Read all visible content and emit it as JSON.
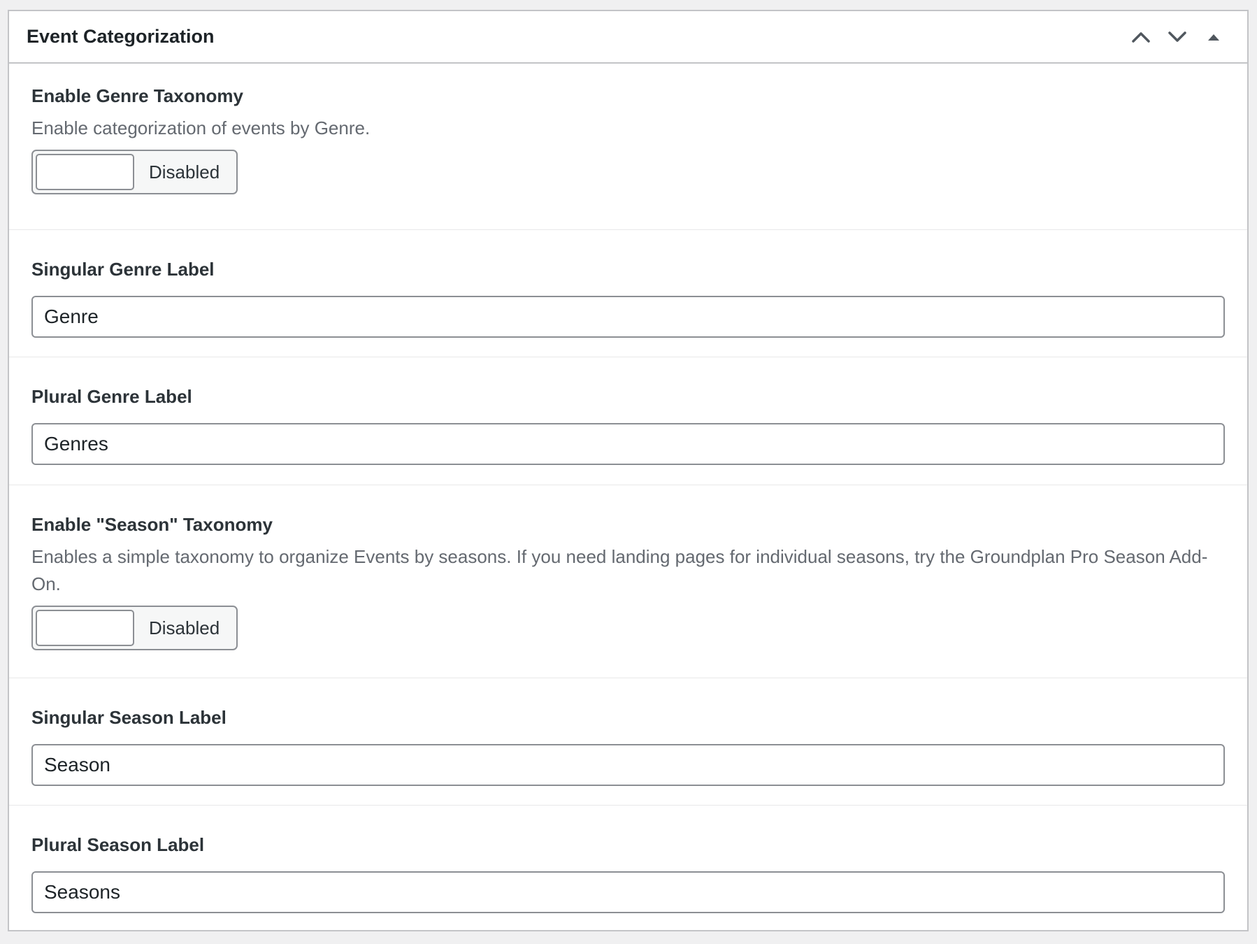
{
  "panel": {
    "title": "Event Categorization",
    "actions": [
      {
        "icon": "chevron-up-icon",
        "label": "Move up"
      },
      {
        "icon": "chevron-down-icon",
        "label": "Move down"
      },
      {
        "icon": "caret-up-icon",
        "label": "Toggle panel"
      }
    ]
  },
  "fields": {
    "genre_toggle": {
      "label": "Enable Genre Taxonomy",
      "description": "Enable categorization of events by Genre.",
      "state": "Disabled"
    },
    "singular_genre": {
      "label": "Singular Genre Label",
      "value": "Genre"
    },
    "plural_genre": {
      "label": "Plural Genre Label",
      "value": "Genres"
    },
    "season_toggle": {
      "label": "Enable \"Season\" Taxonomy",
      "description": "Enables a simple taxonomy to organize Events by seasons. If you need landing pages for individual seasons, try the Groundplan Pro Season Add-On.",
      "state": "Disabled"
    },
    "singular_season": {
      "label": "Singular Season Label",
      "value": "Season"
    },
    "plural_season": {
      "label": "Plural Season Label",
      "value": "Seasons"
    }
  },
  "colors": {
    "border": "#c3c4c7",
    "input_border": "#8c8f94",
    "description": "#646970",
    "text": "#1d2327"
  }
}
